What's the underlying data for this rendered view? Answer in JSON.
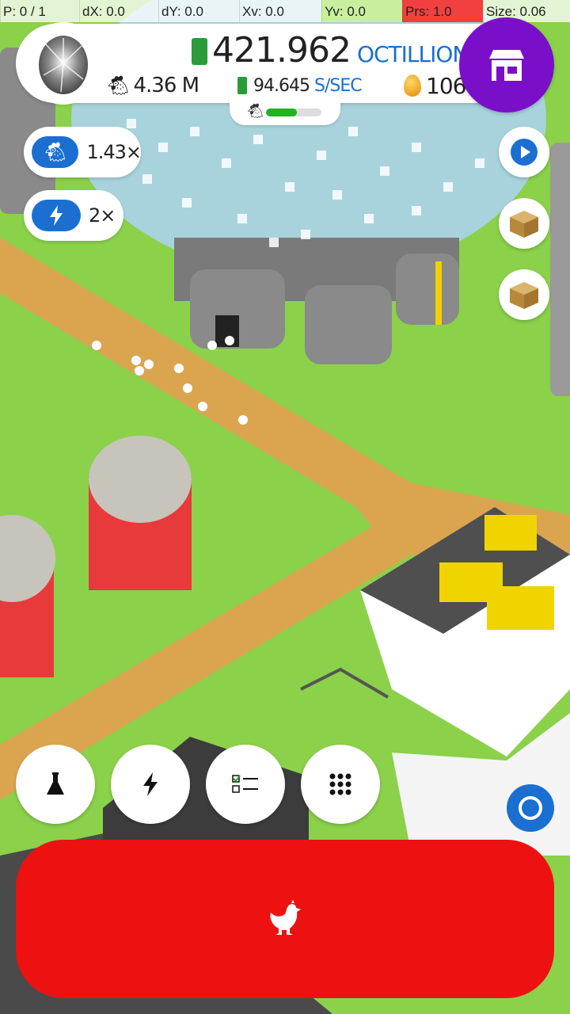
{
  "debug": {
    "pointer": "P: 0 / 1",
    "dx": "dX: 0.0",
    "dy": "dY: 0.0",
    "xv": "Xv: 0.0",
    "yv": "Yv: 0.0",
    "prs": "Prs: 1.0",
    "size": "Size: 0.06"
  },
  "header": {
    "money_value": "421.962",
    "money_unit": "OCTILLION",
    "chicken_count": "4.36 M",
    "rate_value": "94.645",
    "rate_unit": "S/SEC",
    "golden_eggs": "106",
    "hab_progress": 0.55
  },
  "boosts": {
    "chicken_multiplier": "1.43×",
    "speed_multiplier": "2×"
  },
  "colors": {
    "shop": "#7a0fc9",
    "hatch_button": "#ee1111",
    "accent_blue": "#1a6fd1",
    "progress_green": "#21b321"
  },
  "icons": {
    "egg": "egg-icon",
    "shop": "shop-icon",
    "research": "flask-icon",
    "boost": "lightning-icon",
    "missions": "checklist-icon",
    "menu": "grid-icon",
    "hatch": "chicken-icon"
  }
}
